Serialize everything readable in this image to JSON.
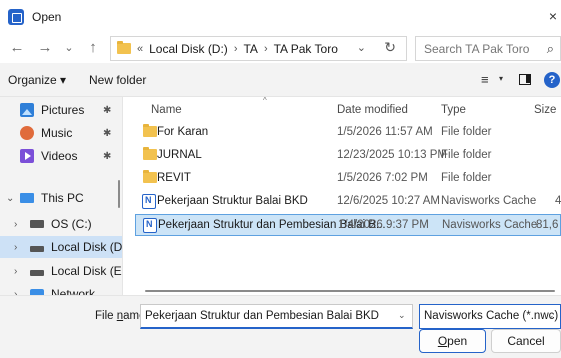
{
  "window": {
    "title": "Open",
    "close_glyph": "×"
  },
  "nav": {
    "back": "←",
    "forward": "→",
    "recent": "⌄",
    "up": "↑"
  },
  "address": {
    "overflow": "«",
    "crumbs": [
      "Local Disk (D:)",
      "TA",
      "TA Pak Toro"
    ],
    "sep": "›",
    "dropdown": "⌄",
    "refresh": "↻"
  },
  "search": {
    "placeholder": "Search TA Pak Toro",
    "icon": "⌕"
  },
  "toolbar": {
    "organize": "Organize ▾",
    "new_folder": "New folder",
    "view_glyph": "≡",
    "view_dd": "▾",
    "help": "?"
  },
  "sidebar": {
    "items": [
      {
        "label": "Pictures",
        "icon": "pictures-icon"
      },
      {
        "label": "Music",
        "icon": "music-icon"
      },
      {
        "label": "Videos",
        "icon": "videos-icon"
      },
      {
        "label": "This PC",
        "icon": "pc-icon"
      },
      {
        "label": "OS (C:)",
        "icon": "drive-icon"
      },
      {
        "label": "Local Disk (D:)",
        "icon": "drive-icon"
      },
      {
        "label": "Local Disk (E:)",
        "icon": "drive-icon"
      },
      {
        "label": "Network",
        "icon": "network-icon"
      }
    ],
    "pin_glyph": "✱",
    "chevron_right": "›",
    "chevron_down": "⌄"
  },
  "columns": {
    "name": "Name",
    "date": "Date modified",
    "type": "Type",
    "size": "Size",
    "sort_glyph": "^"
  },
  "files": [
    {
      "name": "For Karan",
      "date": "1/5/2026 11:57 AM",
      "type": "File folder",
      "size": ""
    },
    {
      "name": "JURNAL",
      "date": "12/23/2025 10:13 PM",
      "type": "File folder",
      "size": ""
    },
    {
      "name": "REVIT",
      "date": "1/5/2026 7:02 PM",
      "type": "File folder",
      "size": ""
    },
    {
      "name": "Pekerjaan Struktur Balai BKD",
      "date": "12/6/2025 10:27 AM",
      "type": "Navisworks Cache",
      "size": "4"
    },
    {
      "name": "Pekerjaan Struktur dan Pembesian Balai B...",
      "date": "1/4/2026 9:37 PM",
      "type": "Navisworks Cache",
      "size": "81,6"
    }
  ],
  "footer": {
    "filename_label_pre": "File ",
    "filename_label_acc": "n",
    "filename_label_post": "ame:",
    "filename_value": "Pekerjaan Struktur dan Pembesian Balai BKD",
    "filetype_value": "Navisworks Cache (*.nwc)",
    "dd_glyph": "⌄",
    "open_acc": "O",
    "open_rest": "pen",
    "cancel": "Cancel"
  }
}
